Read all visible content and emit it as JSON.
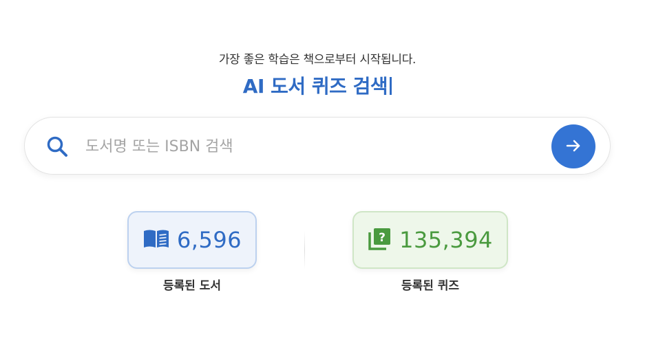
{
  "header": {
    "tagline": "가장 좋은 학습은 책으로부터 시작됩니다.",
    "title": "AI 도서 퀴즈 검색"
  },
  "search": {
    "placeholder": "도서명 또는 ISBN 검색",
    "value": "",
    "search_icon": "search-icon",
    "submit_icon": "arrow-right-icon"
  },
  "stats": {
    "books": {
      "icon": "open-book-icon",
      "value": "6,596",
      "label": "등록된 도서"
    },
    "quizzes": {
      "icon": "question-box-icon",
      "value": "135,394",
      "label": "등록된 퀴즈"
    }
  },
  "colors": {
    "accent_blue": "#2f6bc4",
    "button_blue": "#3474d4",
    "accent_green": "#4a9a3f"
  }
}
